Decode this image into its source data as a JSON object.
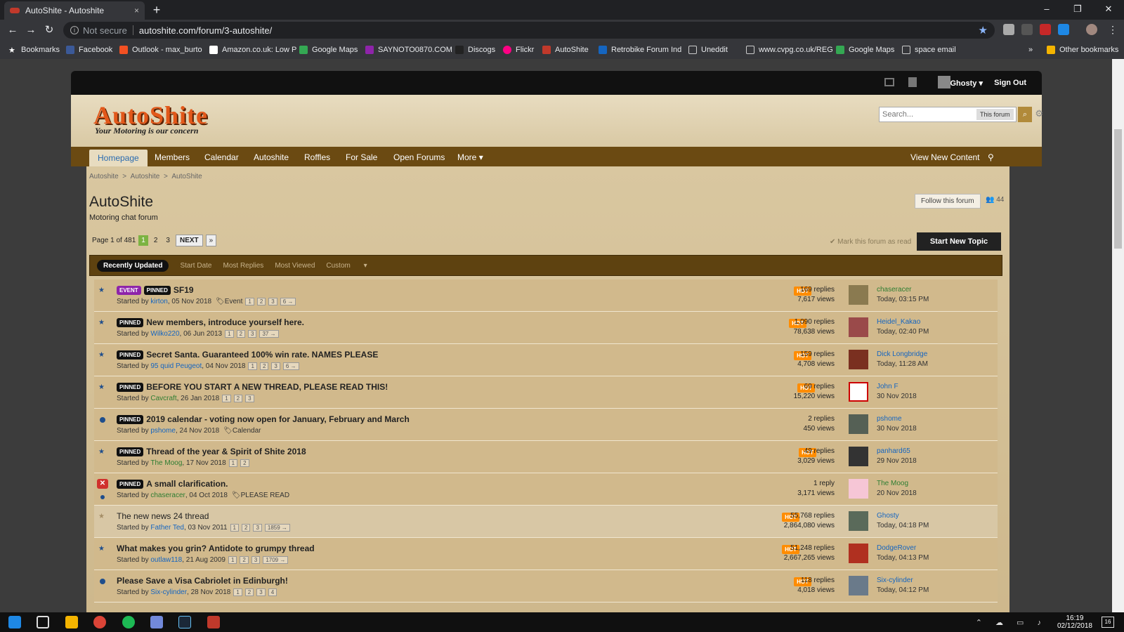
{
  "browser": {
    "tab_title": "AutoShite - Autoshite",
    "tab_close": "×",
    "new_tab": "+",
    "not_secure": "Not secure",
    "url": "autoshite.com/forum/3-autoshite/",
    "win_min": "–",
    "win_max": "❐",
    "win_close": "✕",
    "back": "←",
    "forward": "→",
    "reload": "↻",
    "info": "i",
    "bookmark_star": "★",
    "bookmarks": [
      "Bookmarks",
      "Facebook",
      "Outlook - max_burto",
      "Amazon.co.uk: Low P",
      "Google Maps",
      "SAYNOTO0870.COM",
      "Discogs",
      "Flickr",
      "AutoShite",
      "Retrobike Forum Ind",
      "Uneddit",
      "www.cvpg.co.uk/REG",
      "Google Maps",
      "space email"
    ],
    "more_bookmarks": "»",
    "other_bookmarks": "Other bookmarks"
  },
  "userbar": {
    "username": "Ghosty",
    "user_caret": "▾",
    "sign_out": "Sign Out"
  },
  "header": {
    "logo": "AutoShite",
    "tagline": "Your Motoring is our concern",
    "search_placeholder": "Search...",
    "search_scope": "This forum",
    "search_icon": "⌕",
    "gear_icon": "⚙"
  },
  "nav": {
    "items": [
      "Homepage",
      "Members",
      "Calendar",
      "Autoshite",
      "Roffles",
      "For Sale",
      "Open Forums",
      "More"
    ],
    "more_caret": "▾",
    "view_new": "View New Content",
    "pin_icon": "⚲"
  },
  "breadcrumb": {
    "items": [
      "Autoshite",
      "Autoshite",
      "AutoShite"
    ],
    "sep": ">"
  },
  "forum": {
    "title": "AutoShite",
    "description": "Motoring chat forum",
    "follow": "Follow this forum",
    "followers": "44",
    "followers_icon": "👥",
    "page_label": "Page 1 of 481",
    "pages": [
      "1",
      "2",
      "3"
    ],
    "next": "NEXT",
    "last": "»",
    "mark_read": "✔ Mark this forum as read",
    "start_topic": "Start New Topic",
    "filters": [
      "Recently Updated",
      "Start Date",
      "Most Replies",
      "Most Viewed",
      "Custom"
    ],
    "custom_caret": "▾"
  },
  "topics": [
    {
      "badges": [
        "EVENT",
        "PINNED"
      ],
      "title": "SF19",
      "started_by": "Started by ",
      "author": "kirton",
      "date": ", 05 Nov 2018",
      "tag": "Event",
      "pages": [
        "1",
        "2",
        "3",
        "6 →"
      ],
      "hot": "HOT",
      "replies": "169 replies",
      "views": "7,617 views",
      "last_user": "chaseracer",
      "last_time": "Today, 03:15 PM"
    },
    {
      "badges": [
        "PINNED"
      ],
      "title": "New members, introduce yourself here.",
      "started_by": "Started by ",
      "author": "Wilko220",
      "date": ", 06 Jun 2013",
      "tag": "",
      "pages": [
        "1",
        "2",
        "3",
        "37 →"
      ],
      "hot": "HOT",
      "replies": "1,090 replies",
      "views": "78,638 views",
      "last_user": "Heidel_Kakao",
      "last_time": "Today, 02:40 PM"
    },
    {
      "badges": [
        "PINNED"
      ],
      "title": "Secret Santa. Guaranteed 100% win rate. NAMES PLEASE",
      "started_by": "Started by ",
      "author": "95 quid Peugeot",
      "date": ", 04 Nov 2018",
      "tag": "",
      "pages": [
        "1",
        "2",
        "3",
        "6 →"
      ],
      "hot": "HOT",
      "replies": "159 replies",
      "views": "4,708 views",
      "last_user": "Dick Longbridge",
      "last_time": "Today, 11:28 AM"
    },
    {
      "badges": [
        "PINNED"
      ],
      "title": "BEFORE YOU START A NEW THREAD, PLEASE READ THIS!",
      "started_by": "Started by ",
      "author": "Cavcraft",
      "date": ", 26 Jan 2018",
      "tag": "",
      "pages": [
        "1",
        "2",
        "3"
      ],
      "hot": "HOT",
      "replies": "69 replies",
      "views": "15,220 views",
      "last_user": "John F",
      "last_time": "30 Nov 2018"
    },
    {
      "badges": [
        "PINNED"
      ],
      "title": "2019 calendar - voting now open for January, February and March",
      "started_by": "Started by ",
      "author": "pshome",
      "date": ", 24 Nov 2018",
      "tag": "Calendar",
      "pages": [],
      "hot": "",
      "replies": "2 replies",
      "views": "450 views",
      "last_user": "pshome",
      "last_time": "30 Nov 2018"
    },
    {
      "badges": [
        "PINNED"
      ],
      "title": "Thread of the year & Spirit of Shite 2018",
      "started_by": "Started by ",
      "author": "The Moog",
      "date": ", 17 Nov 2018",
      "tag": "",
      "pages": [
        "1",
        "2"
      ],
      "hot": "HOT",
      "replies": "49 replies",
      "views": "3,029 views",
      "last_user": "panhard65",
      "last_time": "29 Nov 2018"
    },
    {
      "badges": [
        "PINNED"
      ],
      "title": "A small clarification.",
      "started_by": "Started by ",
      "author": "chaseracer",
      "date": ", 04 Oct 2018",
      "tag": "PLEASE READ",
      "pages": [],
      "hot": "",
      "replies": "1 reply",
      "views": "3,171 views",
      "last_user": "The Moog",
      "last_time": "20 Nov 2018"
    },
    {
      "badges": [],
      "title": "The new news 24 thread",
      "started_by": "Started by ",
      "author": "Father Ted",
      "date": ", 03 Nov 2011",
      "tag": "",
      "pages": [
        "1",
        "2",
        "3",
        "1859 →"
      ],
      "hot": "HOT",
      "replies": "55,768 replies",
      "views": "2,864,080 views",
      "last_user": "Ghosty",
      "last_time": "Today, 04:18 PM"
    },
    {
      "badges": [],
      "title": "What makes you grin? Antidote to grumpy thread",
      "started_by": "Started by ",
      "author": "outlaw118",
      "date": ", 21 Aug 2009",
      "tag": "",
      "pages": [
        "1",
        "2",
        "3",
        "1709 →"
      ],
      "hot": "HOT",
      "replies": "51,248 replies",
      "views": "2,667,265 views",
      "last_user": "DodgeRover",
      "last_time": "Today, 04:13 PM"
    },
    {
      "badges": [],
      "title": "Please Save a Visa Cabriolet in Edinburgh!",
      "started_by": "Started by ",
      "author": "Six-cylinder",
      "date": ", 28 Nov 2018",
      "tag": "",
      "pages": [
        "1",
        "2",
        "3",
        "4"
      ],
      "hot": "HOT",
      "replies": "118 replies",
      "views": "4,018 views",
      "last_user": "Six-cylinder",
      "last_time": "Today, 04:12 PM"
    }
  ],
  "taskbar": {
    "time": "16:19",
    "date": "02/12/2018",
    "tray": "⌃ ☁ ▭ ♪",
    "notifications": "16"
  }
}
